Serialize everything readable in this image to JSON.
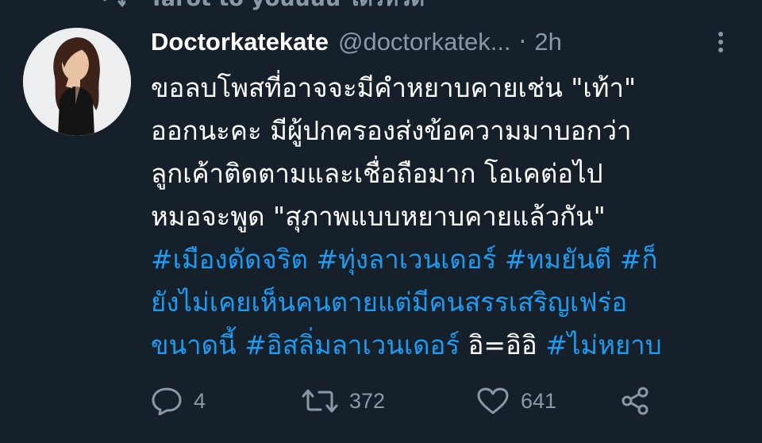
{
  "context": {
    "label": "Tarot to youuuu ได้รีทวีต"
  },
  "tweet": {
    "display_name": "Doctorkatekate",
    "handle": "@doctorkatek...",
    "separator": "·",
    "time": "2h",
    "lines": [
      [
        {
          "text": "ขอลบโพสที่อาจจะมีคำหยาบคายเช่น \"เท้า\"",
          "hashtag": false
        }
      ],
      [
        {
          "text": "ออกนะคะ มีผู้ปกครองส่งข้อความมาบอกว่า",
          "hashtag": false
        }
      ],
      [
        {
          "text": "ลูกเค้าติดตามและเชื่อถือมาก โอเคต่อไป",
          "hashtag": false
        }
      ],
      [
        {
          "text": "หมอจะพูด \"สุภาพแบบหยาบคายแล้วกัน\"",
          "hashtag": false
        }
      ],
      [
        {
          "text": "#เมืองดัดจริต #ทุ่งลาเวนเดอร์ #ทมยันตี #ก็",
          "hashtag": true
        }
      ],
      [
        {
          "text": "ยังไม่เคยเห็นคนตายแต่มีคนสรรเสริญเฟร่อ",
          "hashtag": true
        }
      ],
      [
        {
          "text": "ขนาดนี้ #อิสลิ่มลาเวนเดอร์ ",
          "hashtag": true
        },
        {
          "text": "อิ=อิอิ ",
          "hashtag": false
        },
        {
          "text": "#ไม่หยาบ",
          "hashtag": true
        }
      ]
    ]
  },
  "actions": {
    "reply_count": "4",
    "retweet_count": "372",
    "like_count": "641"
  },
  "colors": {
    "background": "#15202b",
    "text": "#ffffff",
    "secondary": "#8b98a5",
    "link": "#1d9bf0"
  },
  "icons": [
    "retweet-icon",
    "more-icon",
    "reply-icon",
    "retweet-icon",
    "like-icon",
    "share-icon"
  ]
}
